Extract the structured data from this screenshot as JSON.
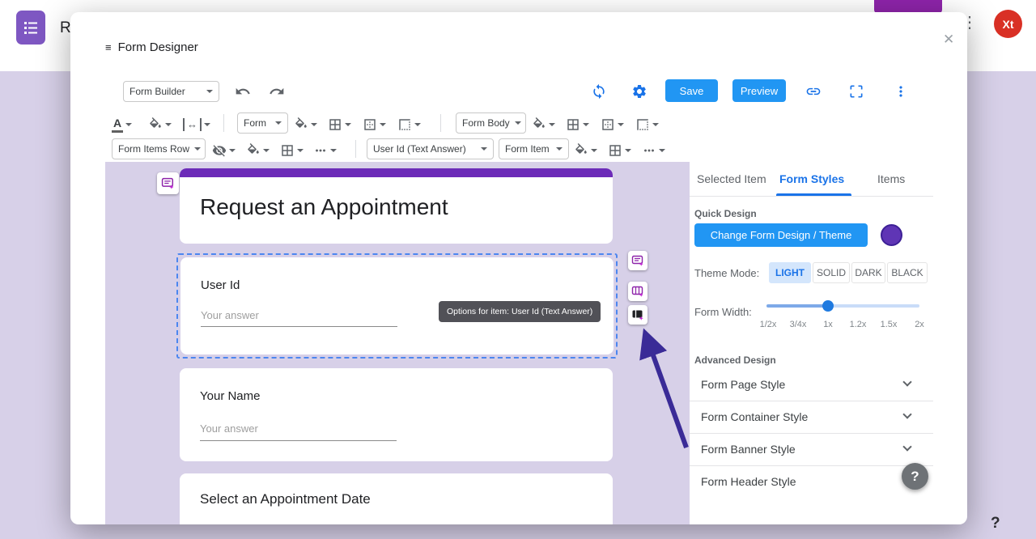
{
  "header": {
    "brand": "R",
    "avatar": "Xt"
  },
  "icons": {
    "menu": "≡",
    "close": "✕",
    "help": "?",
    "width_arrows": "↔",
    "text_color": "A"
  },
  "dialog": {
    "title": "Form Designer"
  },
  "toolbar": {
    "builder": "Form Builder",
    "save": "Save",
    "preview": "Preview"
  },
  "format": {
    "form": "Form",
    "form_body": "Form Body",
    "form_items_row": "Form Items Row",
    "selected_item": "User Id (Text Answer)",
    "form_item": "Form Item"
  },
  "canvas": {
    "form_title": "Request an Appointment",
    "tooltip": "Options for item: User Id (Text Answer)",
    "item1_label": "User Id",
    "item1_placeholder": "Your answer",
    "item2_label": "Your Name",
    "item2_placeholder": "Your answer",
    "item3_label": "Select an Appointment Date"
  },
  "panel": {
    "tabs": [
      "Selected Item",
      "Form Styles",
      "Items"
    ],
    "active_tab": "Form Styles",
    "quick_design": "Quick Design",
    "change_theme": "Change Form Design / Theme",
    "theme_mode_label": "Theme Mode:",
    "theme_modes": [
      "LIGHT",
      "SOLID",
      "DARK",
      "BLACK"
    ],
    "form_width_label": "Form Width:",
    "width_ticks": [
      "1/2x",
      "3/4x",
      "1x",
      "1.2x",
      "1.5x",
      "2x"
    ],
    "advanced_design": "Advanced Design",
    "sections": [
      "Form Page Style",
      "Form Container Style",
      "Form Banner Style",
      "Form Header Style"
    ]
  },
  "colors": {
    "accent_blue": "#2196f3",
    "link_blue": "#1a73e8",
    "banner_purple": "#6c2bb8",
    "swatch_purple": "#5f35b5",
    "arrow_purple": "#3a2b97",
    "canvas_bg": "#d7d0e8",
    "avatar_red": "#d93025"
  }
}
